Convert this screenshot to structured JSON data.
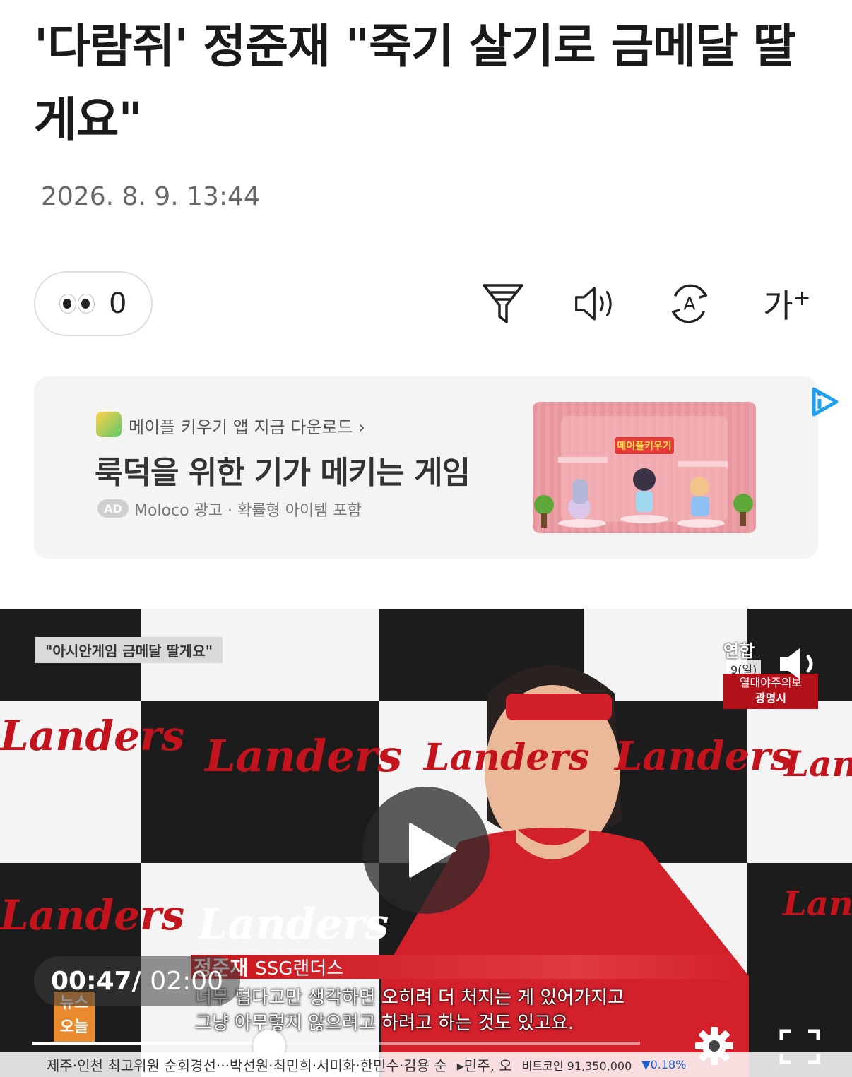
{
  "article": {
    "title": "'다람쥐' 정준재 \"죽기 살기로 금메달 딸게요\"",
    "date": "2026. 8. 9. 13:44"
  },
  "reactions": {
    "icon": "eyes-emoji",
    "count": "0"
  },
  "toolbar": {
    "icons": [
      "filter-icon",
      "speaker-icon",
      "translate-icon",
      "font-size-icon"
    ],
    "font_size_label": "가"
  },
  "ad": {
    "source": "메이플 키우기 앱 지금 다운로드",
    "headline": "룩덕을 위한 기가 메키는 게임",
    "badge": "AD",
    "meta": "Moloco 광고 · 확률형 아이템 포함",
    "image_title": "메이플키우기"
  },
  "video": {
    "tag": "\"아시안게임 금메달 딸게요\"",
    "speaker_name": "정준재",
    "speaker_team": "SSG랜더스",
    "caption_line1": "너무 덥다고만 생각하면 오히려 더 처지는 게 있어가지고",
    "caption_line2": "그냥 아무렇지 않으려고 하려고 하는 것도 있고요.",
    "current_time": "00:47",
    "separator": "/",
    "total_time": "02:00",
    "progress": 0.39,
    "broadcaster": "연합",
    "news_logo": "뉴스 오늘",
    "heat_badge": "열대야주의보",
    "heat_location": "광명시",
    "date_badge": "9(일)",
    "ticker": "제주·인천 최고위원 순회경선···박선원·최민희·서미화·한민수·김용 순",
    "ticker2": "▸민주, 오",
    "ticker_coin": "비트코인 91,350,000",
    "ticker_change": "▼0.18%",
    "logo_text": "Landers",
    "logo_small": "SSG"
  }
}
